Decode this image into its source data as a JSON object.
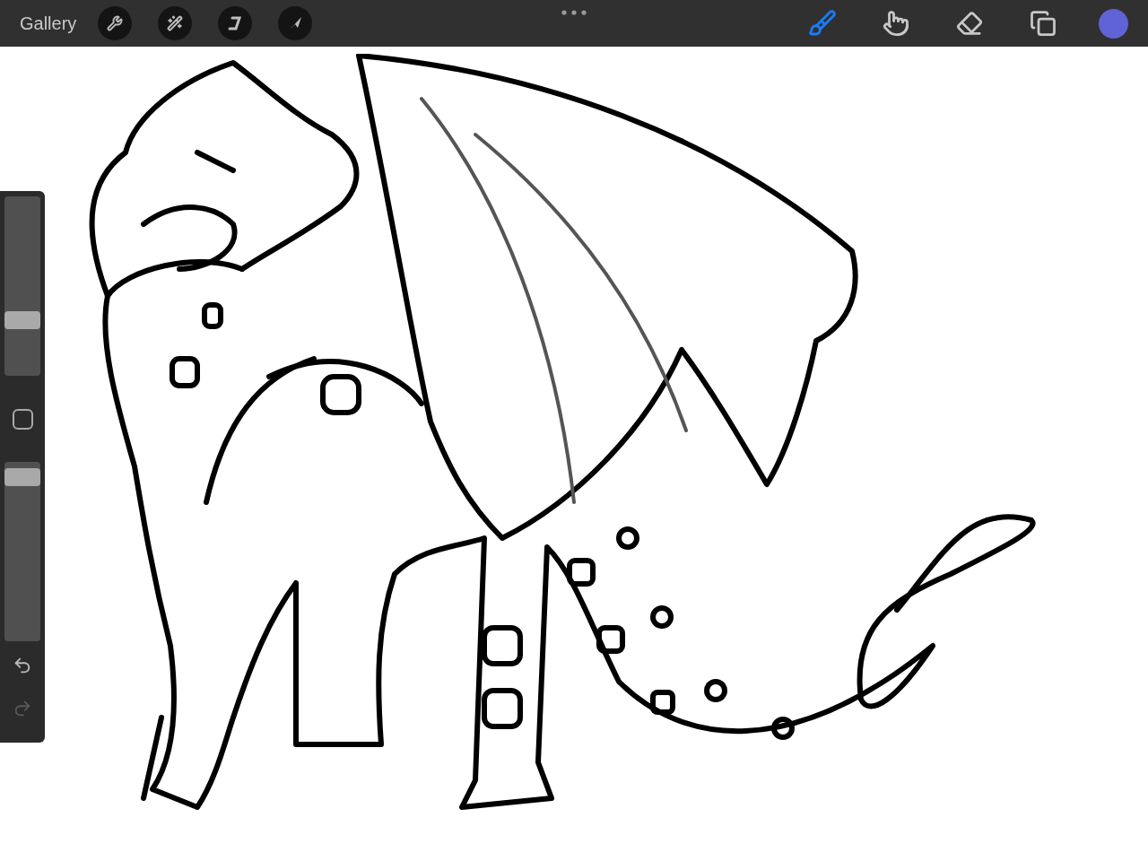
{
  "toolbar": {
    "gallery": "Gallery",
    "actions": [
      {
        "kind": "wrench"
      },
      {
        "kind": "wand"
      },
      {
        "kind": "selection"
      },
      {
        "kind": "transform"
      }
    ],
    "tools": [
      {
        "kind": "brush",
        "selected": true
      },
      {
        "kind": "smudge",
        "selected": false
      },
      {
        "kind": "eraser",
        "selected": false
      },
      {
        "kind": "layers",
        "selected": false
      }
    ],
    "color": "#5f63d6"
  },
  "sidebar": {
    "size": {
      "level": 0.29
    },
    "opacity": {
      "level": 0.96
    },
    "undo": {
      "disabled": false
    },
    "redo": {
      "disabled": true
    }
  }
}
